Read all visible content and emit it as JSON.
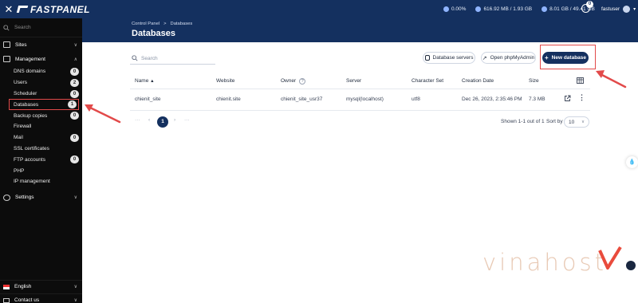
{
  "topbar": {
    "logo": "FASTPANEL",
    "cpu": "0.00%",
    "memory": "616.92 MB / 1.93 GB",
    "disk": "8.01 GB / 49.41 GB",
    "notifications": "0",
    "user": "fastuser"
  },
  "sidebar": {
    "search_placeholder": "Search",
    "sites": "Sites",
    "management": "Management",
    "items": [
      {
        "label": "DNS domains",
        "count": "0"
      },
      {
        "label": "Users",
        "count": "2"
      },
      {
        "label": "Scheduler",
        "count": "0"
      },
      {
        "label": "Databases",
        "count": "1"
      },
      {
        "label": "Backup copies",
        "count": "0"
      },
      {
        "label": "Firewall",
        "count": ""
      },
      {
        "label": "Mail",
        "count": "0"
      },
      {
        "label": "SSL certificates",
        "count": ""
      },
      {
        "label": "FTP accounts",
        "count": "0"
      },
      {
        "label": "PHP",
        "count": ""
      },
      {
        "label": "IP management",
        "count": ""
      }
    ],
    "settings": "Settings",
    "language": "English",
    "contact": "Contact us"
  },
  "header": {
    "breadcrumb_home": "Control Panel",
    "breadcrumb_sep": ">",
    "breadcrumb_current": "Databases",
    "title": "Databases"
  },
  "toolbar": {
    "search_placeholder": "Search",
    "db_servers": "Database servers",
    "phpmyadmin": "Open phpMyAdmin",
    "new_db": "New database"
  },
  "table": {
    "headers": {
      "name": "Name",
      "website": "Website",
      "owner": "Owner",
      "server": "Server",
      "charset": "Character Set",
      "created": "Creation Date",
      "size": "Size"
    },
    "rows": [
      {
        "name": "chienit_site",
        "website": "chienit.site",
        "owner": "chienit_site_usr37",
        "server": "mysql(localhost)",
        "charset": "utf8",
        "created": "Dec 26, 2023, 2:35:46 PM",
        "size": "7.3 MB"
      }
    ]
  },
  "pagination": {
    "first": "···",
    "prev": "‹",
    "page": "1",
    "next": "›",
    "last": "···",
    "shown": "Shown 1-1 out of 1",
    "sort_label": "Sort by",
    "sort_value": "10"
  },
  "watermark": "vinahost",
  "colors": {
    "brand": "#14305f",
    "highlight": "#e24a4a",
    "sidebar": "#0c0c0c"
  }
}
